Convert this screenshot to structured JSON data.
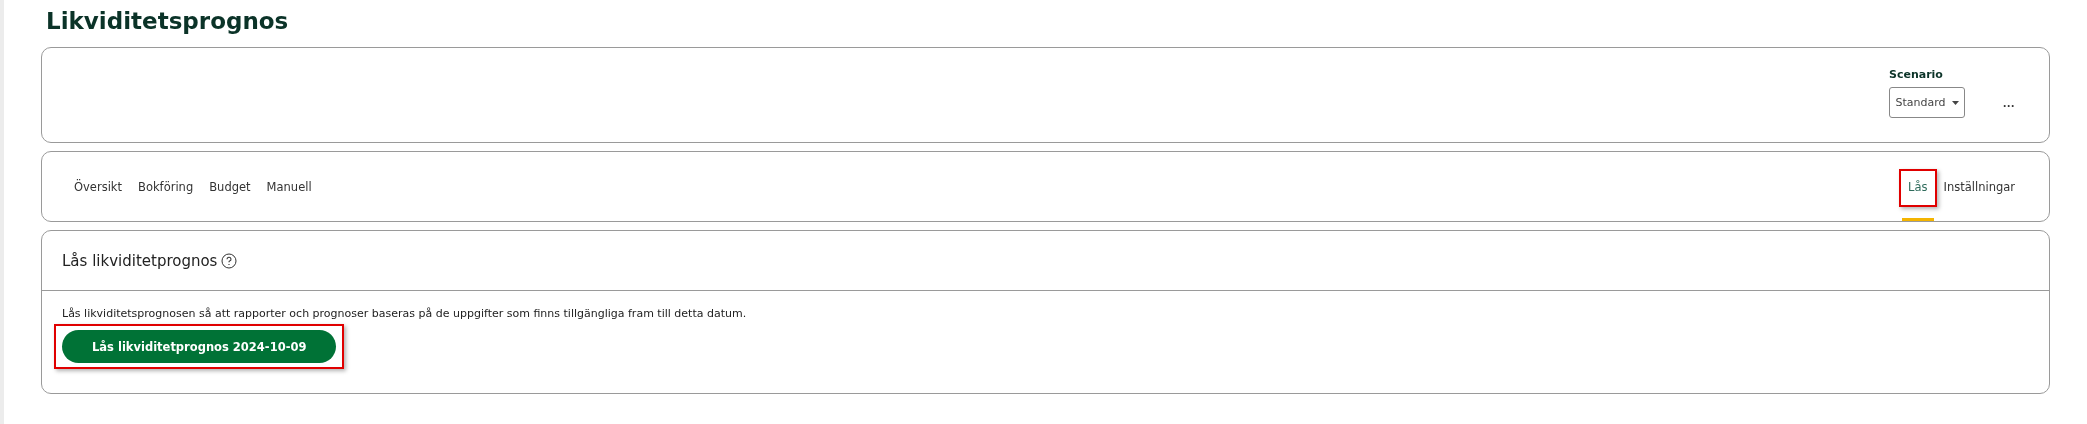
{
  "page_title": "Likviditetsprognos",
  "scenario": {
    "label": "Scenario",
    "value": "Standard",
    "more": "···"
  },
  "tabs_left": [
    {
      "label": "Översikt",
      "selected": false,
      "highlighted": false
    },
    {
      "label": "Bokföring",
      "selected": false,
      "highlighted": false
    },
    {
      "label": "Budget",
      "selected": false,
      "highlighted": false
    },
    {
      "label": "Manuell",
      "selected": false,
      "highlighted": false
    }
  ],
  "tabs_right": [
    {
      "label": "Lås",
      "selected": true,
      "highlighted": true
    },
    {
      "label": "Inställningar",
      "selected": false,
      "highlighted": false
    }
  ],
  "lock_panel": {
    "title": "Lås likviditetprognos",
    "description": "Lås likviditetsprognosen så att rapporter och prognoser baseras på de uppgifter som finns tillgängliga fram till detta datum.",
    "button": {
      "label": "Lås likviditetprognos 2024-10-09",
      "highlighted": true
    }
  }
}
